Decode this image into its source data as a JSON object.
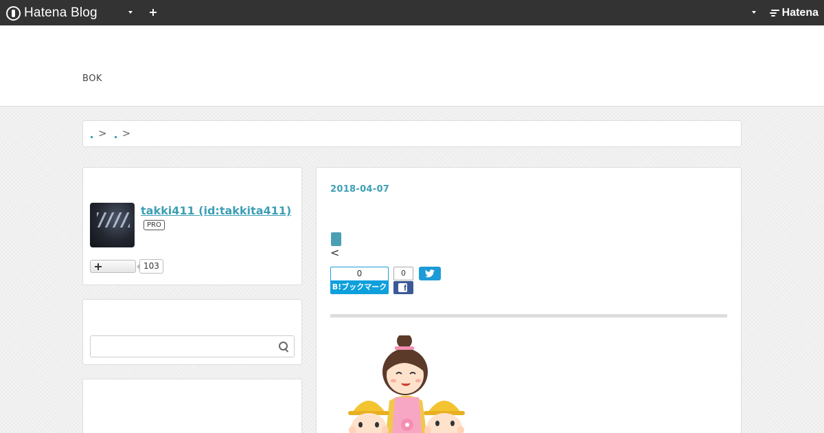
{
  "globalheader": {
    "logo_text": "Hatena Blog",
    "brand_text": "Hatena"
  },
  "blog": {
    "title": "BOK"
  },
  "breadcrumb": {
    "separators": [
      ">",
      ">"
    ]
  },
  "profile": {
    "name": "takki411 (id:takkita411)",
    "badge": "PRO",
    "reader_count": "103"
  },
  "search": {
    "value": "",
    "placeholder": ""
  },
  "entry": {
    "date": "2018-04-07",
    "lt_text": "<",
    "hatena_bookmark": {
      "count": "0",
      "label": "B!ブックマーク"
    },
    "facebook": {
      "count": "0",
      "icon": "f"
    }
  },
  "colors": {
    "header_bg": "#333333",
    "accent": "#3d9fb5",
    "hatena_bookmark": "#0ea0dc",
    "facebook": "#3b5998",
    "twitter": "#1d9bd7"
  },
  "icons": [
    "hatena-blog-logo-icon",
    "chevron-down-icon",
    "plus-icon",
    "hatena-logo-icon",
    "search-icon",
    "facebook-icon",
    "twitter-icon"
  ]
}
